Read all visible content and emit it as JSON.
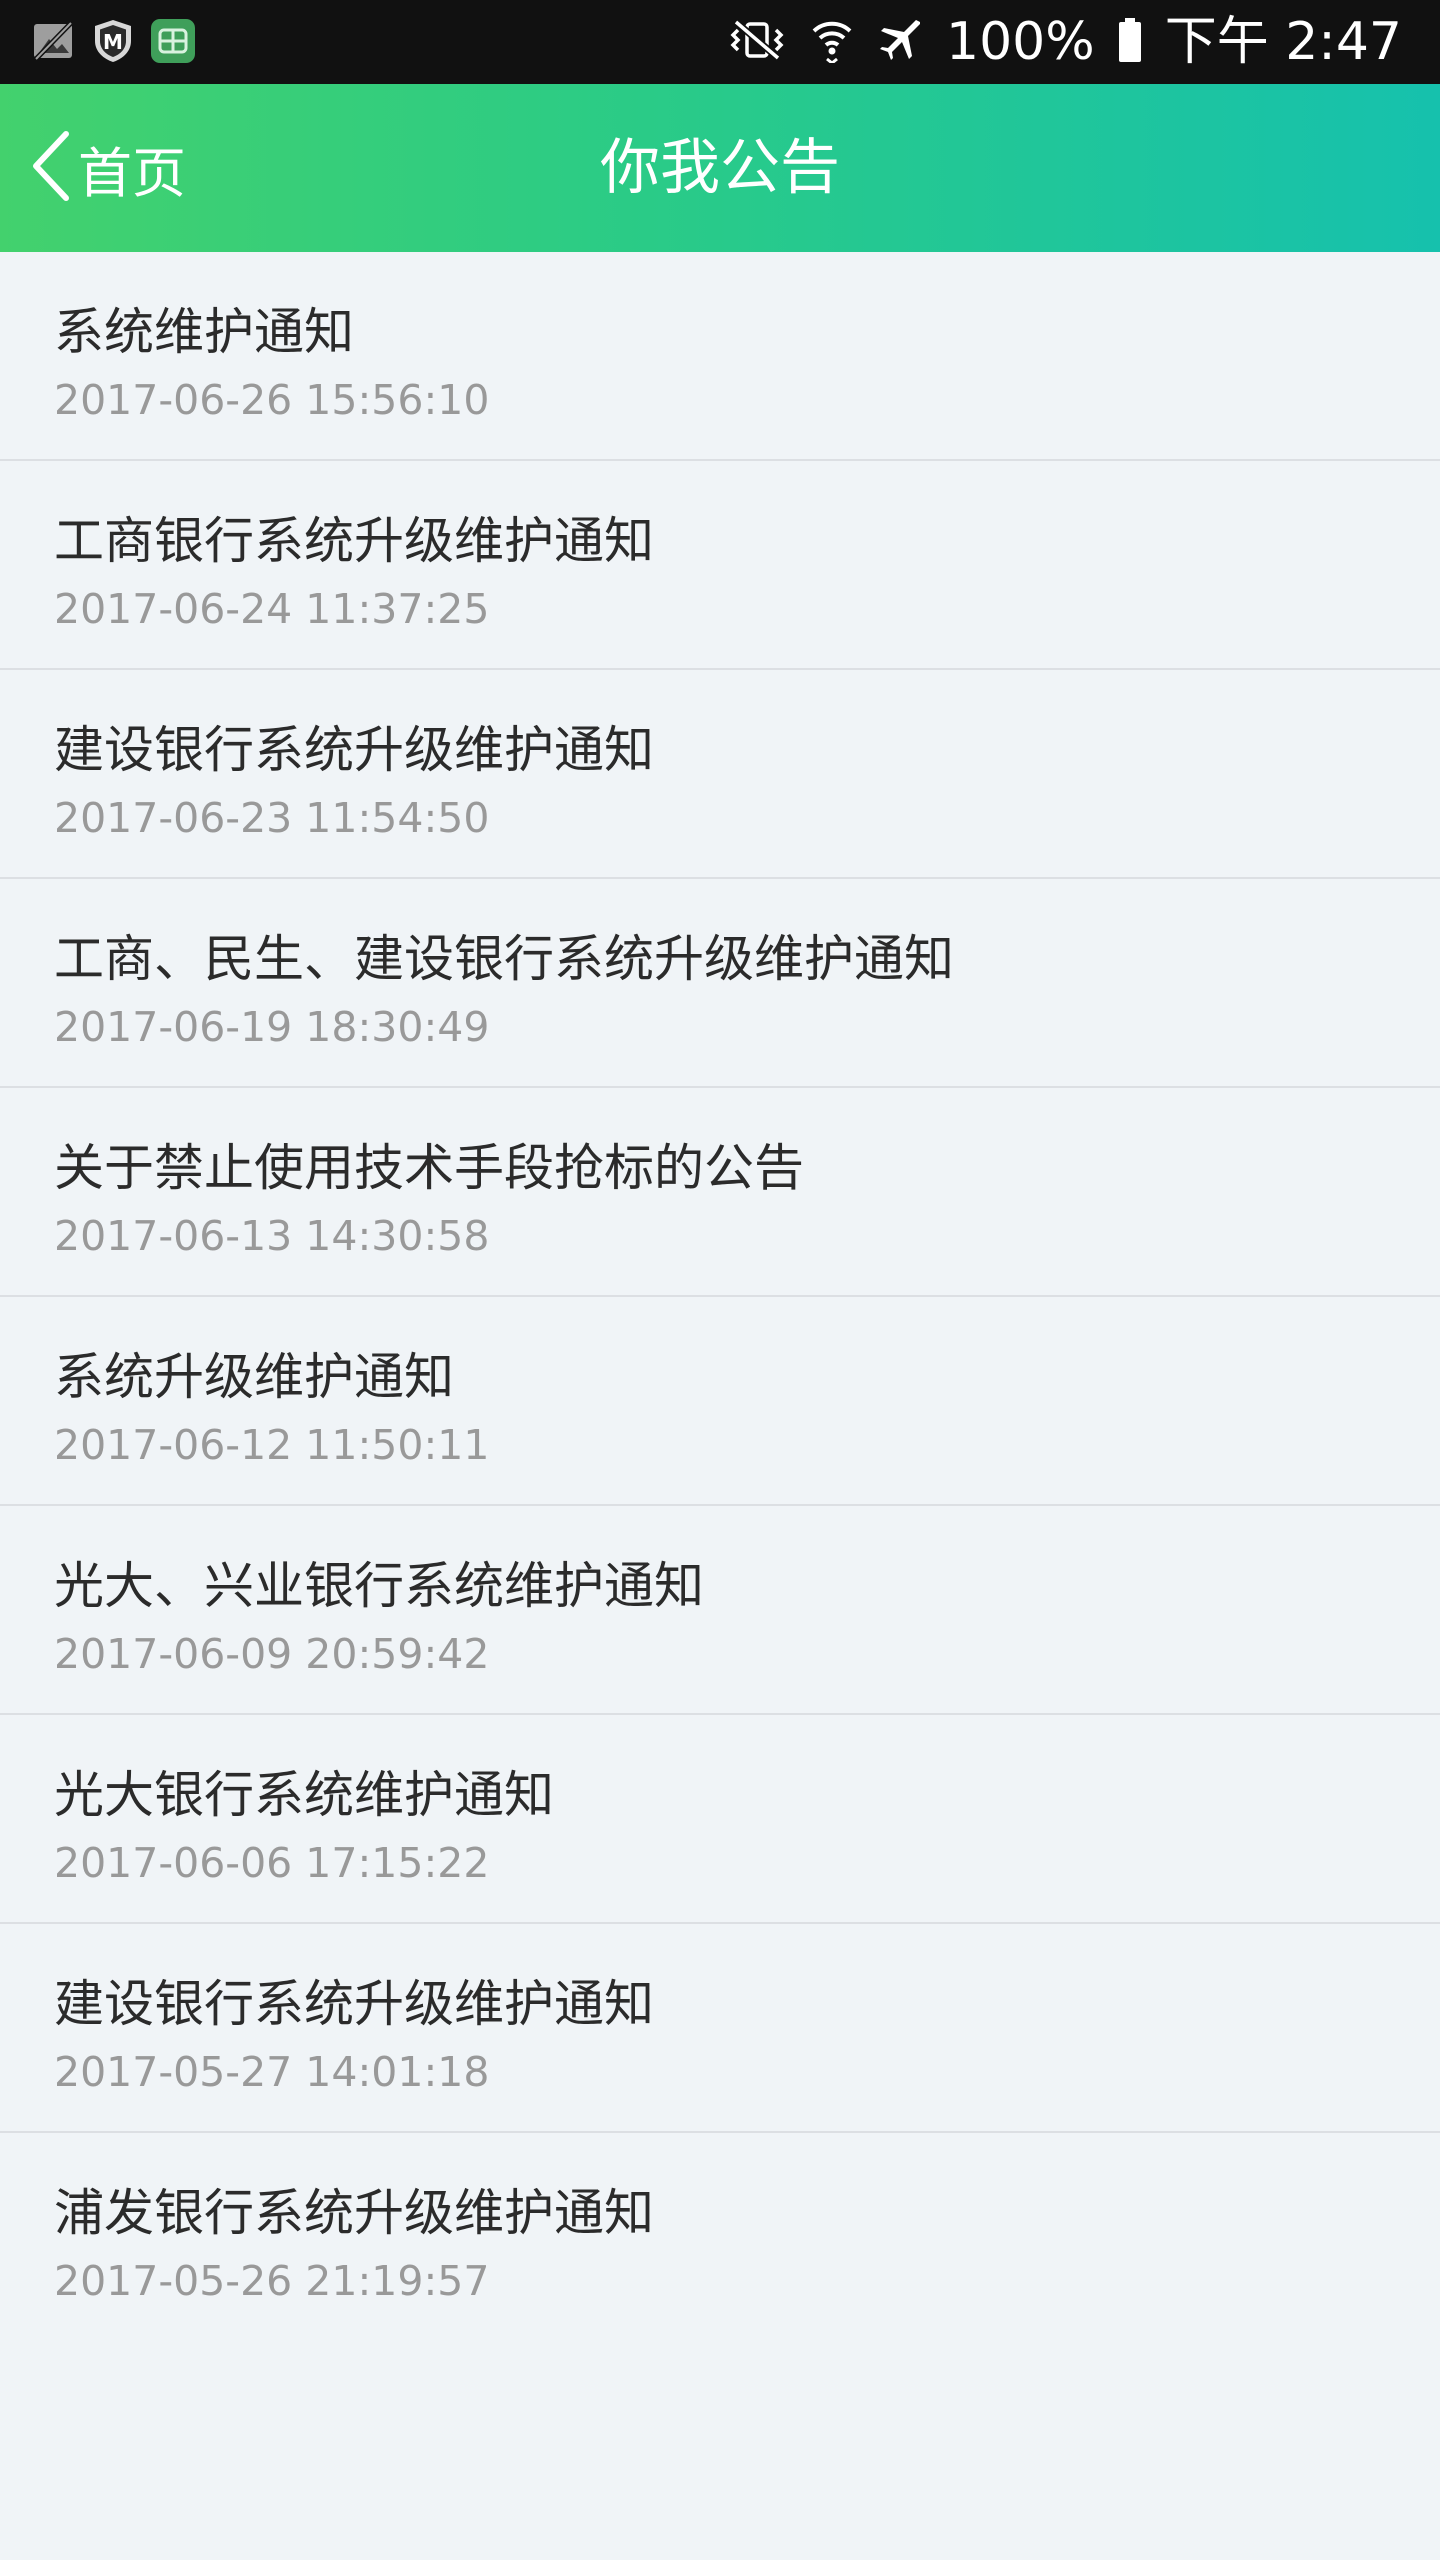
{
  "status_bar": {
    "icons_left": [
      "image-off-icon",
      "shield-m-icon",
      "wallet-app-icon"
    ],
    "icons_right": [
      "vibrate-mute-icon",
      "wifi-icon",
      "airplane-icon",
      "battery-icon"
    ],
    "battery": "100%",
    "time": "下午 2:47"
  },
  "nav": {
    "back_label": "首页",
    "title": "你我公告",
    "gradient": [
      "#43d16d",
      "#16c1ad"
    ]
  },
  "notices": [
    {
      "title": "系统维护通知",
      "time": "2017-06-26 15:56:10"
    },
    {
      "title": "工商银行系统升级维护通知",
      "time": "2017-06-24 11:37:25"
    },
    {
      "title": "建设银行系统升级维护通知",
      "time": "2017-06-23 11:54:50"
    },
    {
      "title": "工商、民生、建设银行系统升级维护通知",
      "time": "2017-06-19 18:30:49"
    },
    {
      "title": "关于禁止使用技术手段抢标的公告",
      "time": "2017-06-13 14:30:58"
    },
    {
      "title": "系统升级维护通知",
      "time": "2017-06-12 11:50:11"
    },
    {
      "title": "光大、兴业银行系统维护通知",
      "time": "2017-06-09 20:59:42"
    },
    {
      "title": "光大银行系统维护通知",
      "time": "2017-06-06 17:15:22"
    },
    {
      "title": "建设银行系统升级维护通知",
      "time": "2017-05-27 14:01:18"
    },
    {
      "title": "浦发银行系统升级维护通知",
      "time": "2017-05-26 21:19:57"
    }
  ]
}
